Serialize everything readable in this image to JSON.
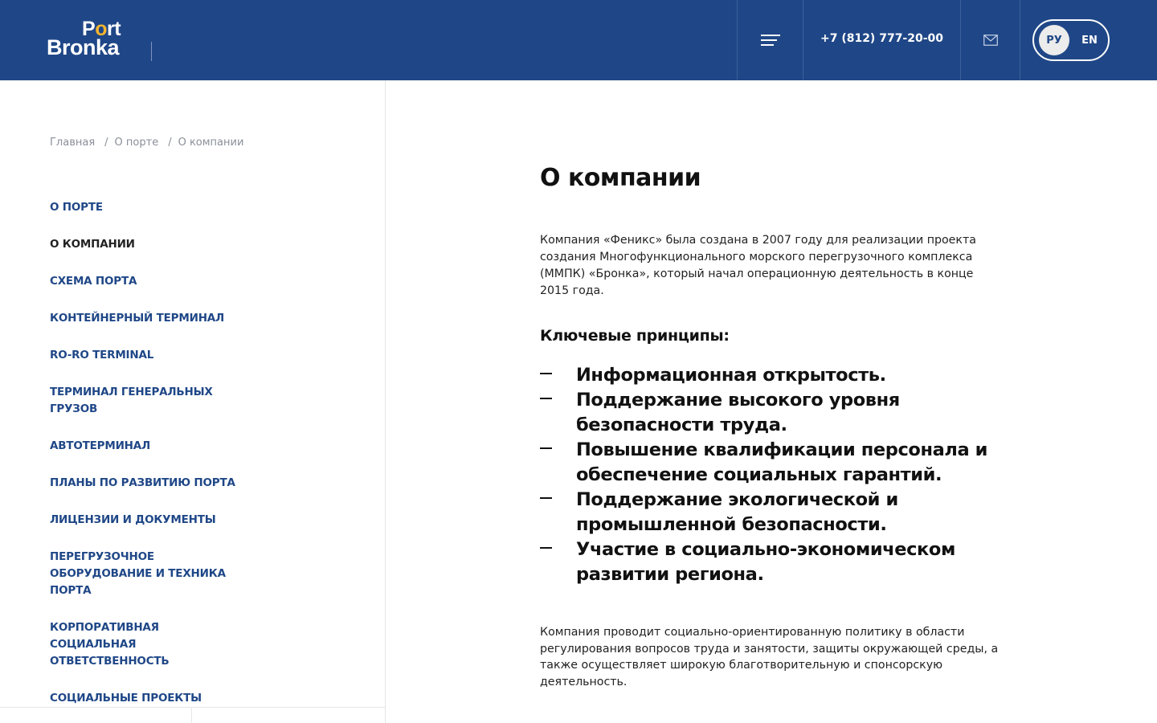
{
  "header": {
    "logo_top": "Port",
    "logo_top_parts": [
      "P",
      "o",
      "rt"
    ],
    "logo_bottom": "Bronka",
    "phone": "+7 (812) 777-20-00",
    "lang_ru": "РУ",
    "lang_en": "EN",
    "colors": {
      "bar": "#1f4787",
      "accent": "#f5b52e"
    }
  },
  "breadcrumb": [
    "Главная",
    "О порте",
    "О компании"
  ],
  "sidebar": {
    "items": [
      {
        "label": "О ПОРТЕ"
      },
      {
        "label": "О КОМПАНИИ",
        "active": true
      },
      {
        "label": "СХЕМА ПОРТА"
      },
      {
        "label": "КОНТЕЙНЕРНЫЙ ТЕРМИНАЛ"
      },
      {
        "label": "RO-RO TERMINAL"
      },
      {
        "label": "ТЕРМИНАЛ ГЕНЕРАЛЬНЫХ ГРУЗОВ"
      },
      {
        "label": "АВТОТЕРМИНАЛ"
      },
      {
        "label": "ПЛАНЫ ПО РАЗВИТИЮ ПОРТА"
      },
      {
        "label": "ЛИЦЕНЗИИ И ДОКУМЕНТЫ"
      },
      {
        "label": "ПЕРЕГРУЗОЧНОЕ ОБОРУДОВАНИЕ И ТЕХНИКА ПОРТА"
      },
      {
        "label": "КОРПОРАТИВНАЯ СОЦИАЛЬНАЯ ОТВЕТСТВЕННОСТЬ"
      },
      {
        "label": "СОЦИАЛЬНЫЕ ПРОЕКТЫ"
      }
    ]
  },
  "main": {
    "title": "О компании",
    "intro": "Компания «Феникс» была создана в 2007 году для реализации проекта создания Многофункционального морского перегрузочного комплекса (ММПК) «Бронка», который начал операционную деятельность в конце 2015 года.",
    "principles_title": "Ключевые принципы:",
    "principles": [
      "Информационная открытость.",
      "Поддержание высокого уровня безопасности труда.",
      "Повышение квалификации персонала и обеспечение социальных гарантий.",
      "Поддержание экологической и промышленной безопасности.",
      "Участие в социально-экономическом развитии региона."
    ],
    "outro": "Компания проводит социально-ориентированную политику в области регулирования вопросов труда и занятости, защиты окружающей среды, а также осуществляет широкую благотворительную и спонсорскую деятельность."
  }
}
